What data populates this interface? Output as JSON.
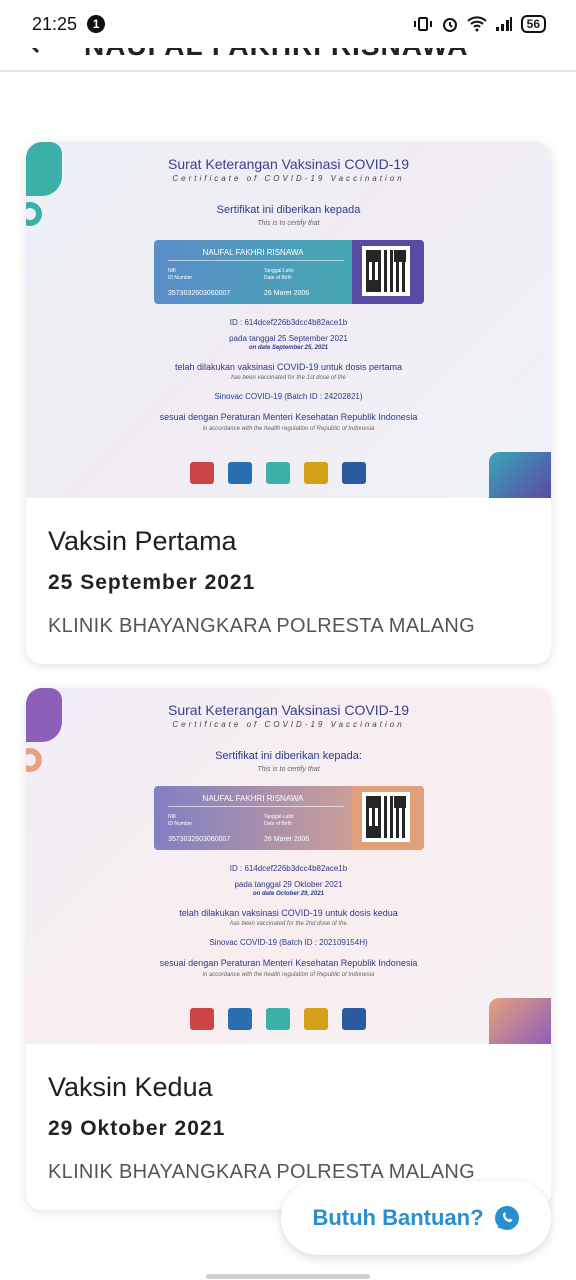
{
  "status_bar": {
    "time": "21:25",
    "notification_count": "1",
    "battery": "56"
  },
  "app_bar": {
    "title": "NAUFAL FAKHRI RISNAWA"
  },
  "cards": [
    {
      "certificate": {
        "title": "Surat Keterangan Vaksinasi COVID-19",
        "subtitle": "Certificate of COVID-19 Vaccination",
        "given_to": "Sertifikat ini diberikan kepada",
        "given_to_en": "This is to certify that",
        "name": "NAUFAL FAKHRI RISNAWA",
        "nik_label": "NIK",
        "nik_label_en": "ID Number",
        "nik": "3573032603060007",
        "dob_label": "Tanggal Lahir",
        "dob_label_en": "Date of Birth",
        "dob": "26 Maret 2006",
        "cert_id": "ID : 614dcef226b3dcc4b82ace1b",
        "date_line": "pada tanggal 25 September 2021",
        "date_line_en": "on date September 25, 2021",
        "dose_line": "telah dilakukan vaksinasi COVID-19 untuk dosis pertama",
        "dose_line_en": "has been vaccinated for the 1st dose of the",
        "vaccine": "Sinovac COVID-19 (Batch ID : 24202821)",
        "regulation": "sesuai dengan Peraturan Menteri Kesehatan Republik Indonesia",
        "regulation_en": "in accordance with the health regulation of Republic of Indonesia"
      },
      "title": "Vaksin Pertama",
      "date": "25 September 2021",
      "place": "KLINIK BHAYANGKARA POLRESTA MALANG"
    },
    {
      "certificate": {
        "title": "Surat Keterangan Vaksinasi COVID-19",
        "subtitle": "Certificate of COVID-19 Vaccination",
        "given_to": "Sertifikat ini diberikan kepada:",
        "given_to_en": "This is to certify that",
        "name": "NAUFAL FAKHRI RISNAWA",
        "nik_label": "NIK",
        "nik_label_en": "ID Number",
        "nik": "3573032603060007",
        "dob_label": "Tanggal Lahir",
        "dob_label_en": "Date of Birth",
        "dob": "26 Maret 2006",
        "cert_id": "ID : 614dcef226b3dcc4b82ace1b",
        "date_line": "pada tanggal 29 Oktober 2021",
        "date_line_en": "on date October 29, 2021",
        "dose_line": "telah dilakukan vaksinasi COVID-19 untuk dosis kedua",
        "dose_line_en": "has been vaccinated for the 2nd dose of the",
        "vaccine": "Sinovac COVID-19 (Batch ID : 202109154H)",
        "regulation": "sesuai dengan Peraturan Menteri Kesehatan Republik Indonesia",
        "regulation_en": "in accordance with the health regulation of Republic of Indonesia"
      },
      "title": "Vaksin Kedua",
      "date": "29 Oktober 2021",
      "place": "KLINIK BHAYANGKARA POLRESTA MALANG"
    }
  ],
  "help_button": {
    "label": "Butuh Bantuan?"
  },
  "colors": {
    "accent": "#2a8fd0",
    "teal": "#3bb0a8",
    "purple": "#5b4aa4",
    "peach": "#e5a27d"
  },
  "icons": {
    "back": "back-arrow-icon",
    "whatsapp": "whatsapp-icon",
    "notification": "alarm-icon",
    "wifi": "wifi-icon",
    "signal": "signal-icon"
  }
}
